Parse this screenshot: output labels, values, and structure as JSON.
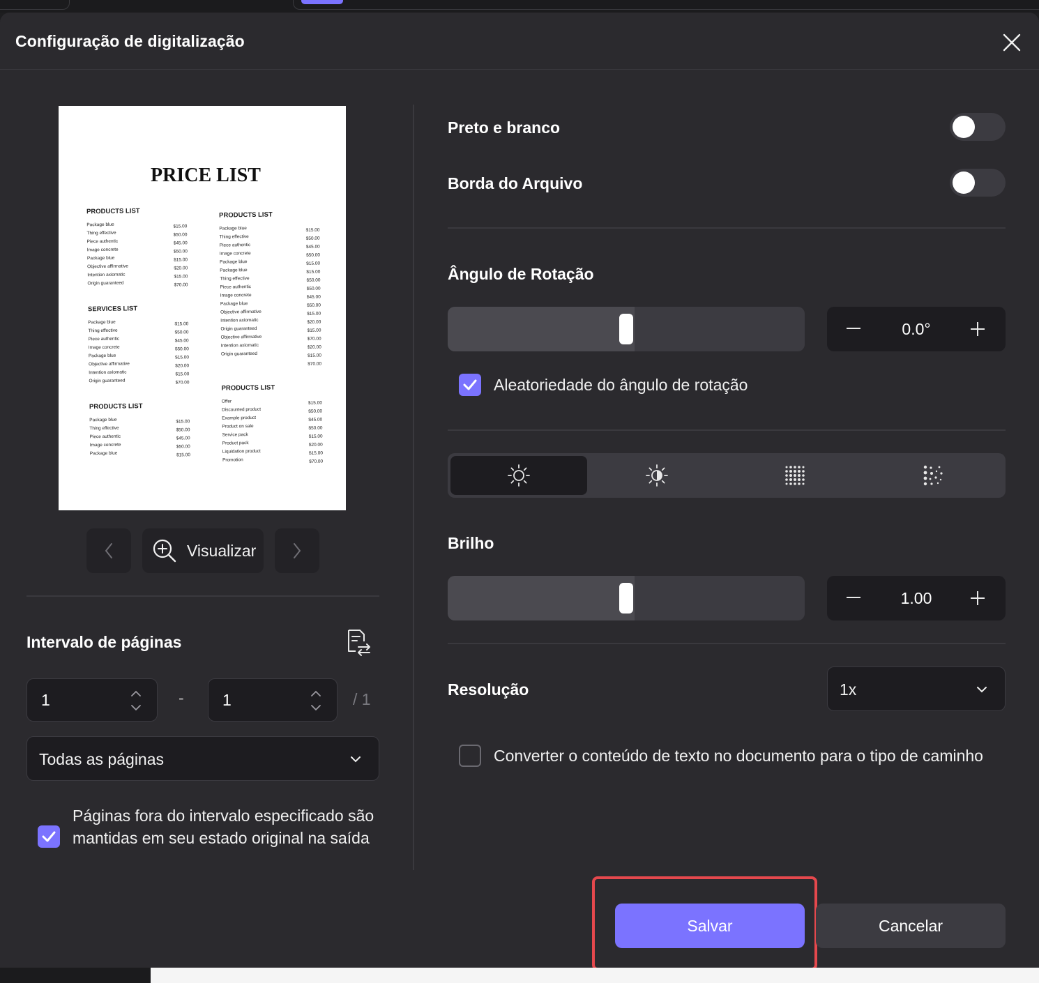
{
  "dialog": {
    "title": "Configuração de digitalização"
  },
  "preview": {
    "doc_title": "PRICE LIST",
    "col1": [
      {
        "heading": "PRODUCTS LIST",
        "items": [
          "Package blue",
          "Thing effective",
          "Piece authentic",
          "Image concrete",
          "Package blue",
          "Objective affirmative",
          "Intention axiomatic",
          "Origin guaranteed"
        ],
        "prices": [
          "$15.00",
          "$50.00",
          "$45.00",
          "$50.00",
          "$15.00",
          "$20.00",
          "$15.00",
          "$70.00"
        ]
      },
      {
        "heading": "SERVICES LIST",
        "items": [
          "Package blue",
          "Thing effective",
          "Piece authentic",
          "Image concrete",
          "Package blue",
          "Objective affirmative",
          "Intention axiomatic",
          "Origin guaranteed"
        ],
        "prices": [
          "$15.00",
          "$50.00",
          "$45.00",
          "$50.00",
          "$15.00",
          "$20.00",
          "$15.00",
          "$70.00"
        ]
      },
      {
        "heading": "PRODUCTS LIST",
        "items": [
          "Package blue",
          "Thing effective",
          "Piece authentic",
          "Image concrete",
          "Package blue"
        ],
        "prices": [
          "$15.00",
          "$50.00",
          "$45.00",
          "$50.00",
          "$15.00"
        ]
      }
    ],
    "col2": [
      {
        "heading": "PRODUCTS LIST",
        "items": [
          "Package blue",
          "Thing effective",
          "Piece authentic",
          "Image concrete",
          "Package blue",
          "Package blue",
          "Thing effective",
          "Piece authentic",
          "Image concrete",
          "Package blue",
          "Objective affirmative",
          "Intention axiomatic",
          "Origin guaranteed",
          "Objective affirmative",
          "Intention axiomatic",
          "Origin guaranteed"
        ],
        "prices": [
          "$15.00",
          "$50.00",
          "$45.00",
          "$50.00",
          "$15.00",
          "$15.00",
          "$50.00",
          "$50.00",
          "$45.00",
          "$50.00",
          "$15.00",
          "$20.00",
          "$15.00",
          "$70.00",
          "$20.00",
          "$15.00",
          "$70.00"
        ]
      },
      {
        "heading": "PRODUCTS LIST",
        "items": [
          "Offer",
          "Discounted product",
          "Example product",
          "Product on sale",
          "Service pack",
          "Product pack",
          "Liquidation product",
          "Promotion"
        ],
        "prices": [
          "$15.00",
          "$50.00",
          "$45.00",
          "$50.00",
          "$15.00",
          "$20.00",
          "$15.00",
          "$70.00"
        ]
      }
    ]
  },
  "nav": {
    "prev_icon": "chevron-left-icon",
    "next_icon": "chevron-right-icon",
    "view_label": "Visualizar",
    "view_icon": "zoom-in-icon"
  },
  "page_range": {
    "label": "Intervalo de páginas",
    "icon": "page-swap-icon",
    "from": "1",
    "to": "1",
    "separator": "-",
    "total": "/ 1",
    "mode": "Todas as páginas",
    "keep_outside_label": "Páginas fora do intervalo especificado são mantidas em seu estado original na saída",
    "keep_outside_checked": true
  },
  "settings": {
    "black_white_label": "Preto e branco",
    "black_white_on": false,
    "file_border_label": "Borda do Arquivo",
    "file_border_on": false,
    "rotation_label": "Ângulo de Rotação",
    "rotation_value": "0.0°",
    "rotation_level": 0.5,
    "random_rotation_label": "Aleatoriedade do ângulo de rotação",
    "random_rotation_checked": true,
    "adjust_tabs": [
      "brightness-icon",
      "contrast-icon",
      "sharpness-icon",
      "noise-icon"
    ],
    "active_tab": 0,
    "brightness_label": "Brilho",
    "brightness_value": "1.00",
    "brightness_level": 0.5,
    "resolution_label": "Resolução",
    "resolution_value": "1x",
    "convert_text_label": "Converter o conteúdo de texto no documento para o tipo de caminho",
    "convert_text_checked": false
  },
  "actions": {
    "save_label": "Salvar",
    "cancel_label": "Cancelar"
  },
  "colors": {
    "accent": "#7b73ff",
    "background": "#2b2a2e",
    "highlight": "#e5484d"
  }
}
